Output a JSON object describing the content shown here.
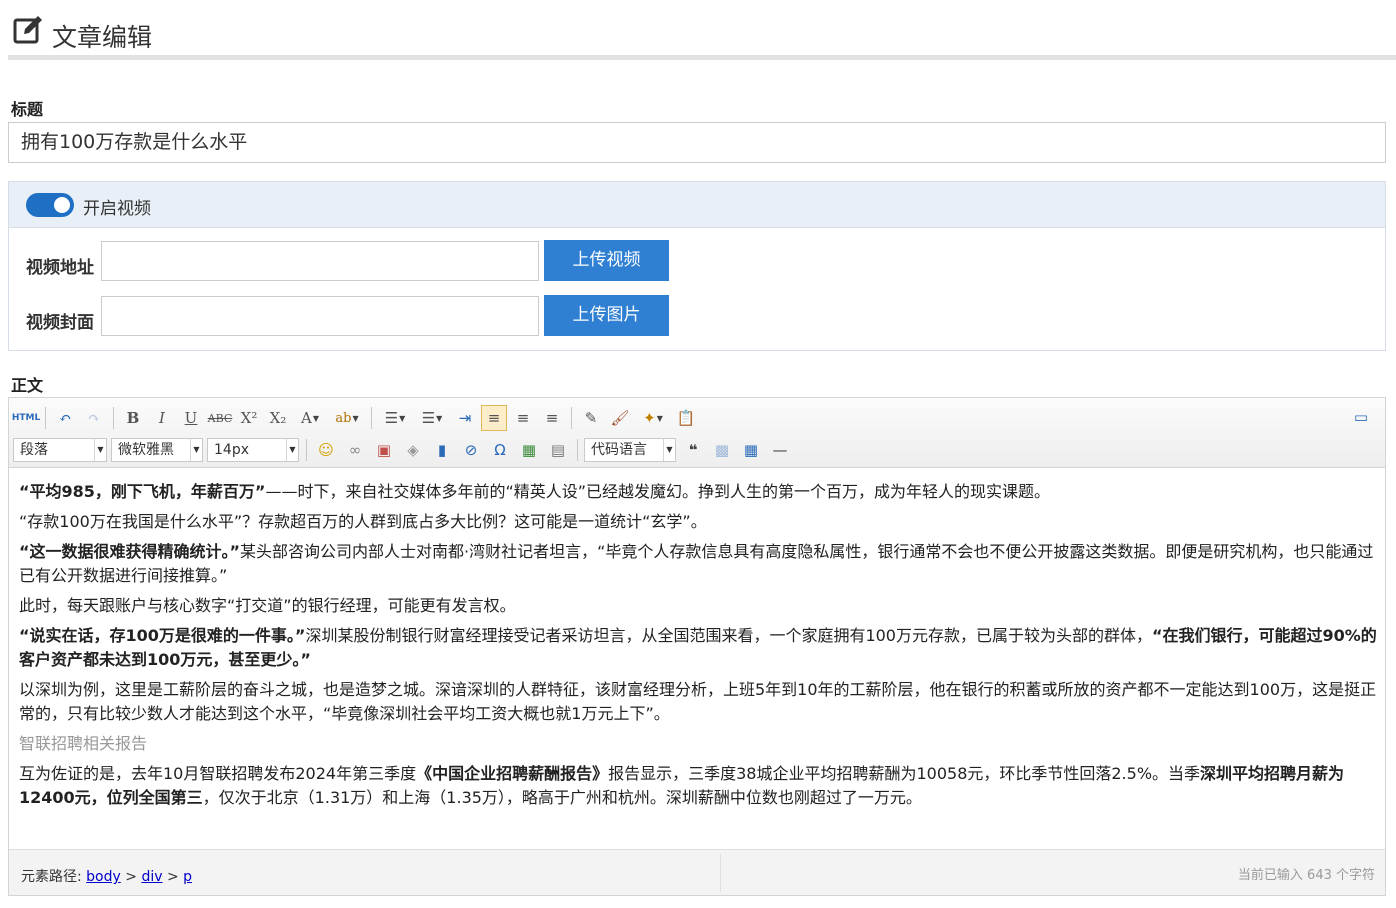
{
  "header": {
    "title": "文章编辑",
    "icon": "edit-icon"
  },
  "title_field": {
    "label": "标题",
    "value": "拥有100万存款是什么水平"
  },
  "video": {
    "toggle_label": "开启视频",
    "toggle_on": true,
    "url_label": "视频地址",
    "url_value": "",
    "upload_video_button": "上传视频",
    "cover_label": "视频封面",
    "cover_value": "",
    "upload_image_button": "上传图片"
  },
  "body": {
    "label": "正文",
    "toolbar": {
      "html_label": "HTML",
      "paragraph_select": "段落",
      "font_family_select": "微软雅黑",
      "font_size_select": "14px",
      "code_lang_select": "代码语言"
    },
    "content": {
      "p1_b": "“平均985，刚下飞机，年薪百万”",
      "p1_t": "——时下，来自社交媒体多年前的“精英人设”已经越发魔幻。挣到人生的第一个百万，成为年轻人的现实课题。",
      "p2": "“存款100万在我国是什么水平”？存款超百万的人群到底占多大比例？这可能是一道统计“玄学”。",
      "p3_b": "“这一数据很难获得精确统计。”",
      "p3_t": "某头部咨询公司内部人士对南都·湾财社记者坦言，“毕竟个人存款信息具有高度隐私属性，银行通常不会也不便公开披露这类数据。即便是研究机构，也只能通过已有公开数据进行间接推算。”",
      "p4": "此时，每天跟账户与核心数字“打交道”的银行经理，可能更有发言权。",
      "p5_b1": "“说实在话，存100万是很难的一件事。”",
      "p5_t": "深圳某股份制银行财富经理接受记者采访坦言，从全国范围来看，一个家庭拥有100万元存款，已属于较为头部的群体，",
      "p5_b2": "“在我们银行，可能超过90%的客户资产都未达到100万元，甚至更少。”",
      "p6": "以深圳为例，这里是工薪阶层的奋斗之城，也是造梦之城。深谙深圳的人群特征，该财富经理分析，上班5年到10年的工薪阶层，他在银行的积蓄或所放的资产都不一定能达到100万，这是挺正常的，只有比较少数人才能达到这个水平，“毕竟像深圳社会平均工资大概也就1万元上下”。",
      "h_sub": "智联招聘相关报告",
      "p7_a": "互为佐证的是，去年10月智联招聘发布2024年第三季度",
      "p7_b": "《中国企业招聘薪酬报告》",
      "p7_c": "报告显示，三季度38城企业平均招聘薪酬为10058元，环比季节性回落2.5%。当季",
      "p7_d": "深圳平均招聘月薪为12400元，位列全国第三",
      "p7_e": "，仅次于北京（1.31万）和上海（1.35万），略高于广州和杭州。深圳薪酬中位数也刚超过了一万元。"
    },
    "status": {
      "path_label": "元素路径:",
      "path": [
        "body",
        "div",
        "p"
      ],
      "count_text": "当前已输入 643 个字符"
    }
  },
  "colors": {
    "accent": "#2f7fd3",
    "toggle": "#1f6fc5",
    "panel_header": "#e9eff6"
  }
}
